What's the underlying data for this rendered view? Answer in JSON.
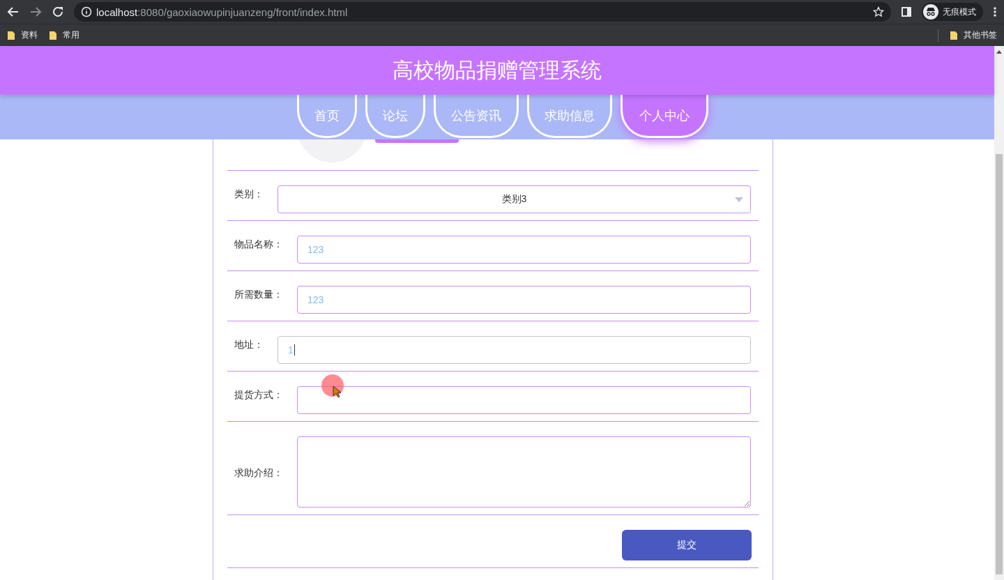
{
  "browser": {
    "url_host": "localhost",
    "url_path": ":8080/gaoxiaowupinjuanzeng/front/index.html",
    "incognito_label": "无痕模式",
    "bookmarks": [
      "资料",
      "常用"
    ],
    "other_bookmarks": "其他书签"
  },
  "header": {
    "title": "高校物品捐赠管理系统"
  },
  "nav": [
    {
      "label": "首页",
      "selected": false
    },
    {
      "label": "论坛",
      "selected": false
    },
    {
      "label": "公告资讯",
      "selected": false
    },
    {
      "label": "求助信息",
      "selected": false
    },
    {
      "label": "个人中心",
      "selected": true
    }
  ],
  "form": {
    "fields": [
      {
        "kind": "select",
        "label": "类别：",
        "value": "类别3",
        "focused": false
      },
      {
        "kind": "input",
        "label": "物品名称：",
        "value": "123",
        "focused": false
      },
      {
        "kind": "input",
        "label": "所需数量：",
        "value": "123",
        "focused": false
      },
      {
        "kind": "input",
        "label": "地址：",
        "value": "1",
        "focused": true
      },
      {
        "kind": "input",
        "label": "提货方式：",
        "focused": false
      },
      {
        "kind": "textarea",
        "label": "求助介绍：",
        "focused": false
      }
    ],
    "submit": "提交"
  }
}
